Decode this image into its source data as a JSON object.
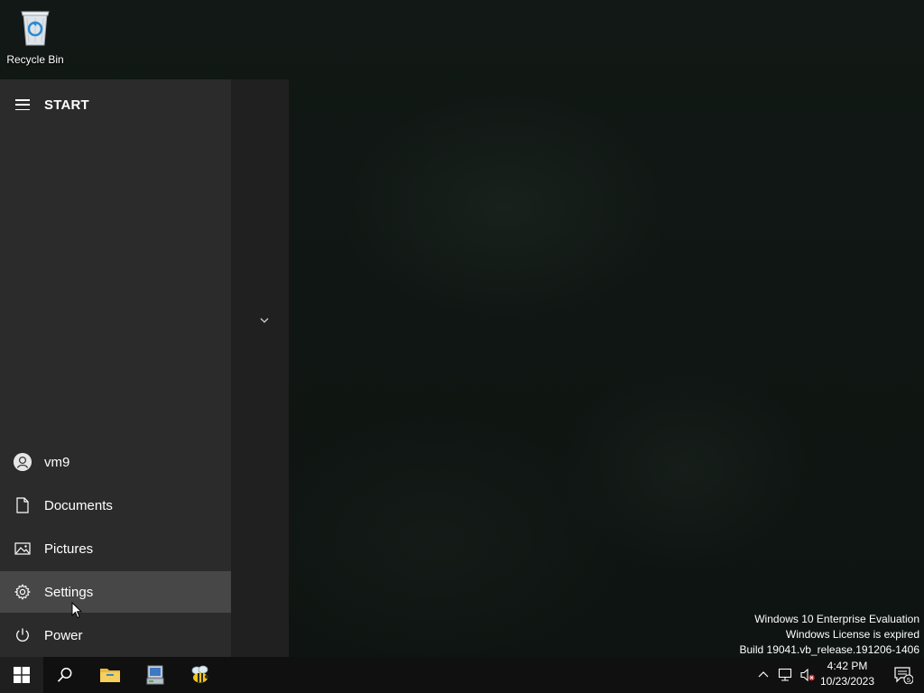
{
  "desktop": {
    "icons": [
      {
        "label": "Recycle Bin",
        "icon": "recycle-bin-icon"
      }
    ]
  },
  "start_menu": {
    "title": "START",
    "header_icon": "hamburger-menu-icon",
    "expand_icon": "chevron-down-icon",
    "items": [
      {
        "label": "vm9",
        "icon": "user-avatar-icon"
      },
      {
        "label": "Documents",
        "icon": "document-icon"
      },
      {
        "label": "Pictures",
        "icon": "pictures-icon"
      },
      {
        "label": "Settings",
        "icon": "gear-icon",
        "hovered": true
      },
      {
        "label": "Power",
        "icon": "power-icon"
      }
    ]
  },
  "watermark": {
    "line1": "Windows 10 Enterprise Evaluation",
    "line2": "Windows License is expired",
    "line3": "Build 19041.vb_release.191206-1406"
  },
  "taskbar": {
    "buttons": [
      {
        "name": "start",
        "icon": "windows-logo-icon"
      },
      {
        "name": "search",
        "icon": "search-icon"
      },
      {
        "name": "file-explorer",
        "icon": "folder-icon"
      },
      {
        "name": "network-app",
        "icon": "computer-app-icon"
      },
      {
        "name": "bee-app",
        "icon": "bee-app-icon"
      }
    ],
    "tray": {
      "time": "4:42 PM",
      "date": "10/23/2023",
      "notification_count": "5",
      "icons": [
        "chevron-up-icon",
        "network-icon",
        "volume-muted-icon"
      ]
    }
  }
}
